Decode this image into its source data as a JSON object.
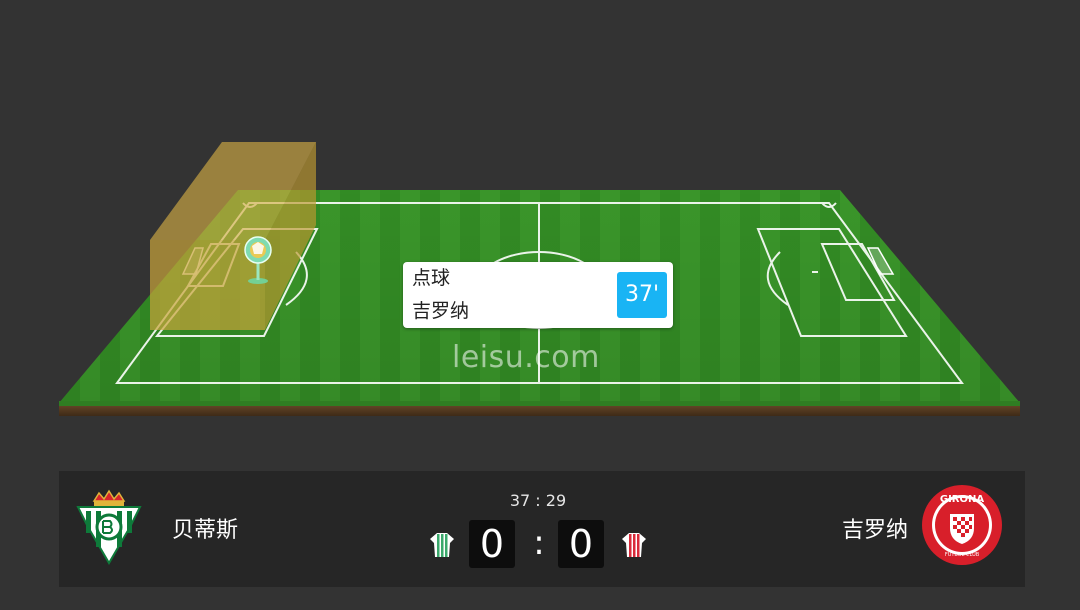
{
  "event": {
    "type": "点球",
    "team": "吉罗纳",
    "minute": "37'"
  },
  "watermark": "leisu.com",
  "match": {
    "clock": "37 : 29",
    "home": {
      "name": "贝蒂斯",
      "score": "0",
      "jersey_color": "#3aa86b"
    },
    "away": {
      "name": "吉罗纳",
      "score": "0",
      "jersey_color": "#d92a3a"
    },
    "separator": ":"
  },
  "colors": {
    "page_bg": "#333333",
    "pitch_green": "#3c9a2a",
    "highlight_zone": "#c9a43a",
    "minute_badge": "#19b4f4"
  },
  "icons": {
    "ball_marker": "soccer-ball-icon",
    "home_logo": "real-betis-crest",
    "away_logo": "girona-crest"
  },
  "logos": {
    "away_text": "GIRONA",
    "away_subtext": "FUTBOL CLUB"
  }
}
